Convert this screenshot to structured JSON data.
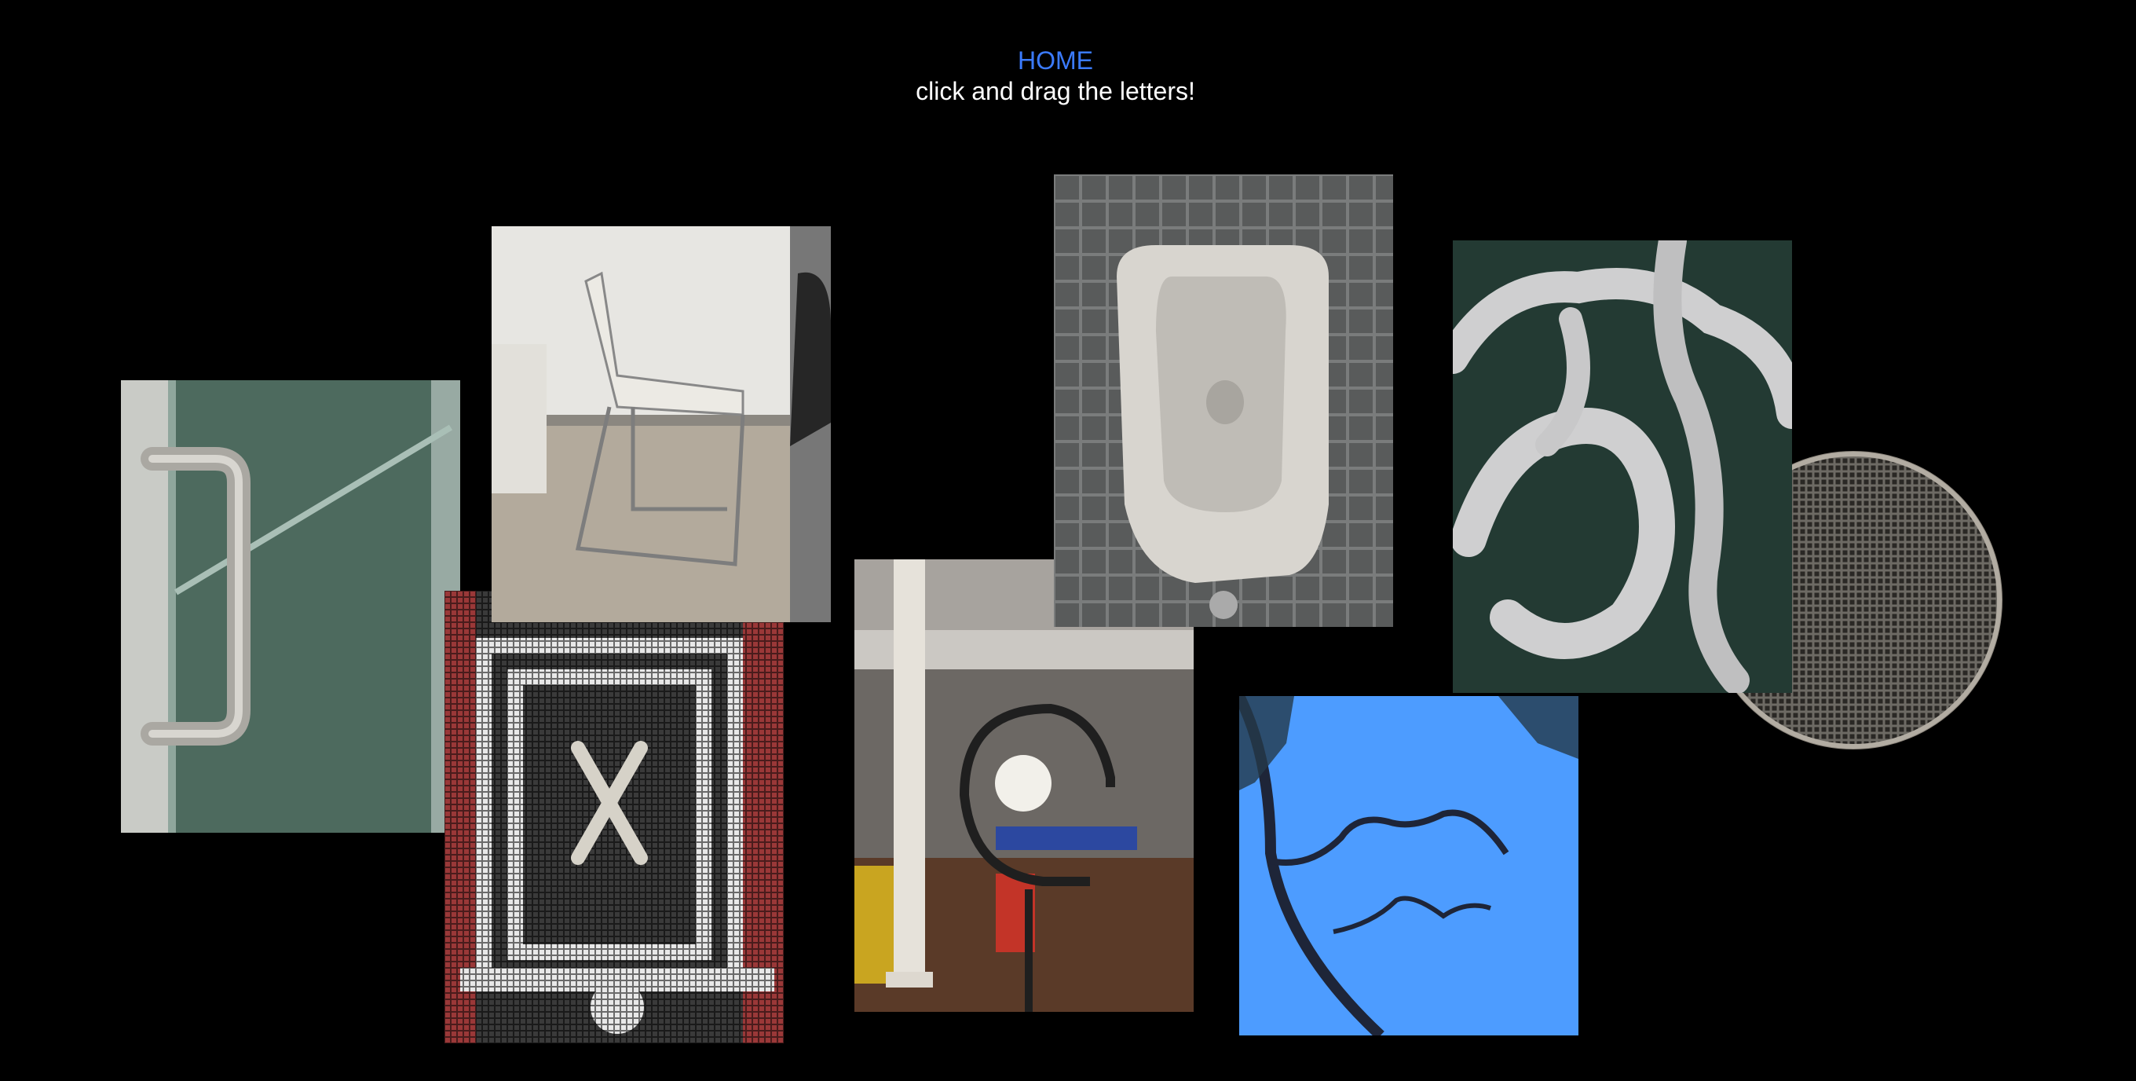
{
  "header": {
    "home_label": "HOME",
    "instruction": "click and drag the letters!"
  },
  "letters": [
    {
      "letter": "D",
      "photo": "steel door pull handle on green glass door"
    },
    {
      "letter": "h",
      "photo": "white chair with chrome frame in office"
    },
    {
      "letter": "X",
      "photo": "black red and white tile mosaic"
    },
    {
      "letter": "e",
      "photo": "curved black lamp in office with column"
    },
    {
      "letter": "U",
      "photo": "white urinal on grey tile wall"
    },
    {
      "letter": "K",
      "photo": "bare tree branches against blue sky"
    },
    {
      "letter": "S",
      "photo": "white sculptural metal gate"
    },
    {
      "letter": "O",
      "photo": "round metal grate"
    }
  ],
  "colors": {
    "background": "#000000",
    "home_link": "#3b7bff",
    "subtitle": "#ffffff",
    "sky": "#4d9cff"
  }
}
